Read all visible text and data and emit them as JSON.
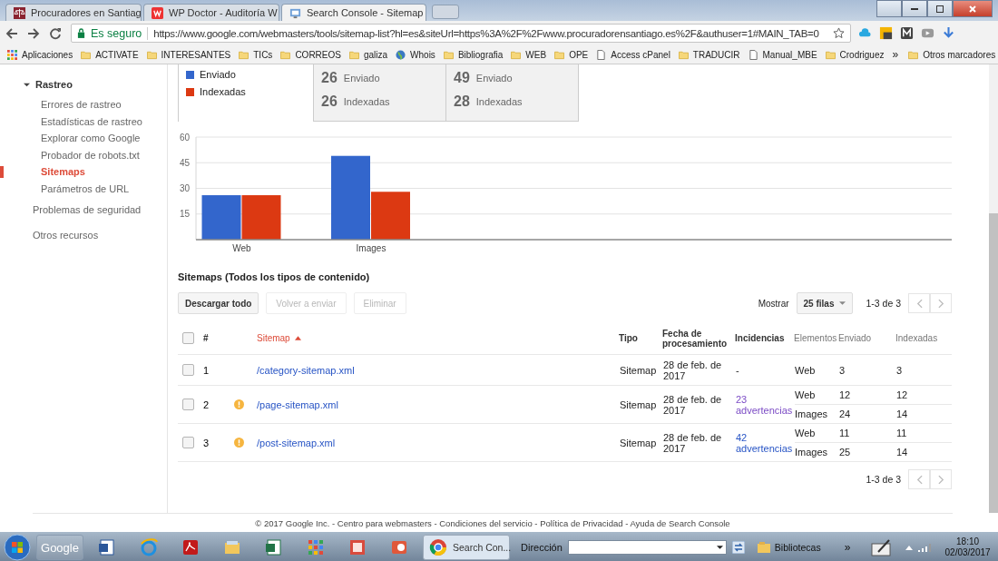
{
  "browser": {
    "tabs": [
      {
        "title": "Procuradores en Santiag",
        "selected": false
      },
      {
        "title": "WP Doctor - Auditoría W",
        "selected": false
      },
      {
        "title": "Search Console - Sitemap",
        "selected": true
      }
    ],
    "security": "Es seguro",
    "url": "https://www.google.com/webmasters/tools/sitemap-list?hl=es&siteUrl=https%3A%2F%2Fwww.procuradorensantiago.es%2F&authuser=1#MAIN_TAB=0",
    "bookmarks": [
      {
        "label": "Aplicaciones",
        "kind": "apps"
      },
      {
        "label": "ACTIVATE",
        "kind": "folder"
      },
      {
        "label": "INTERESANTES",
        "kind": "folder"
      },
      {
        "label": "TICs",
        "kind": "folder"
      },
      {
        "label": "CORREOS",
        "kind": "folder"
      },
      {
        "label": "galiza",
        "kind": "folder"
      },
      {
        "label": "Whois",
        "kind": "globe"
      },
      {
        "label": "Bibliografia",
        "kind": "folder"
      },
      {
        "label": "WEB",
        "kind": "folder"
      },
      {
        "label": "OPE",
        "kind": "folder"
      },
      {
        "label": "Access cPanel",
        "kind": "page"
      },
      {
        "label": "TRADUCIR",
        "kind": "folder"
      },
      {
        "label": "Manual_MBE",
        "kind": "page"
      },
      {
        "label": "Crodriguez",
        "kind": "folder"
      }
    ],
    "bookmarks_more": "»",
    "other_bookmarks": "Otros marcadores"
  },
  "sidebar": {
    "group": {
      "label": "Rastreo",
      "expanded": true,
      "children": [
        {
          "label": "Errores de rastreo",
          "selected": false
        },
        {
          "label": "Estadísticas de rastreo",
          "selected": false
        },
        {
          "label": "Explorar como Google",
          "selected": false
        },
        {
          "label": "Probador de robots.txt",
          "selected": false
        },
        {
          "label": "Sitemaps",
          "selected": true
        },
        {
          "label": "Parámetros de URL",
          "selected": false
        }
      ]
    },
    "links": [
      "Problemas de seguridad",
      "Otros recursos"
    ]
  },
  "summary": {
    "cards": [
      {
        "stats": [
          {
            "value": "26",
            "label": "Enviado"
          },
          {
            "value": "26",
            "label": "Indexadas"
          }
        ]
      },
      {
        "stats": [
          {
            "value": "49",
            "label": "Enviado"
          },
          {
            "value": "28",
            "label": "Indexadas"
          }
        ]
      }
    ]
  },
  "chart": {
    "chart_data": {
      "type": "bar",
      "categories": [
        "Web",
        "Images"
      ],
      "series": [
        {
          "name": "Enviado",
          "color": "#3366cc",
          "values": [
            26,
            49
          ]
        },
        {
          "name": "Indexadas",
          "color": "#dc3912",
          "values": [
            26,
            28
          ]
        }
      ],
      "ylim": [
        0,
        60
      ],
      "yticks": [
        15,
        30,
        45,
        60
      ],
      "grid": true
    }
  },
  "table": {
    "title": "Sitemaps (Todos los tipos de contenido)",
    "actions": [
      {
        "label": "Descargar todo",
        "disabled": false
      },
      {
        "label": "Volver a enviar",
        "disabled": true
      },
      {
        "label": "Eliminar",
        "disabled": true
      }
    ],
    "show_label": "Mostrar",
    "rows_per_page": "25 filas",
    "range": "1-3 de 3",
    "header_checked": false,
    "columns": [
      {
        "label": "#",
        "sorted": false
      },
      {
        "label": "Sitemap",
        "sorted": true
      },
      {
        "label": "Tipo",
        "sorted": false
      },
      {
        "label": "Fecha de procesamiento",
        "sorted": false
      },
      {
        "label": "Incidencias",
        "sorted": false
      },
      {
        "label": "Elementos",
        "sorted": false
      },
      {
        "label": "Enviado",
        "sorted": false
      },
      {
        "label": "Indexadas",
        "sorted": false
      }
    ],
    "rows": [
      {
        "checked": false,
        "num": "1",
        "warning": false,
        "sitemap": "/category-sitemap.xml",
        "type": "Sitemap",
        "date": "28 de feb. de 2017",
        "issues": "-",
        "issues_link": false,
        "items": [
          {
            "type": "Web",
            "submitted": "3",
            "indexed": "3"
          }
        ]
      },
      {
        "checked": false,
        "num": "2",
        "warning": true,
        "sitemap": "/page-sitemap.xml",
        "type": "Sitemap",
        "date": "28 de feb. de 2017",
        "issues": "23 advertencias",
        "issues_link": true,
        "visited": true,
        "items": [
          {
            "type": "Web",
            "submitted": "12",
            "indexed": "12"
          },
          {
            "type": "Images",
            "submitted": "24",
            "indexed": "14"
          }
        ]
      },
      {
        "checked": false,
        "num": "3",
        "warning": true,
        "sitemap": "/post-sitemap.xml",
        "type": "Sitemap",
        "date": "28 de feb. de 2017",
        "issues": "42 advertencias",
        "issues_link": true,
        "visited": false,
        "items": [
          {
            "type": "Web",
            "submitted": "11",
            "indexed": "11"
          },
          {
            "type": "Images",
            "submitted": "25",
            "indexed": "14"
          }
        ]
      }
    ],
    "footer_range": "1-3 de 3"
  },
  "footer": "© 2017 Google Inc. - Centro para webmasters - Condiciones del servicio - Política de Privacidad - Ayuda de Search Console",
  "taskbar": {
    "apps": [
      {
        "kind": "google",
        "label": "Google",
        "selected": false
      },
      {
        "kind": "word",
        "selected": false
      },
      {
        "kind": "ie",
        "selected": false
      },
      {
        "kind": "pdf",
        "selected": false
      },
      {
        "kind": "explorer",
        "selected": false
      },
      {
        "kind": "excel",
        "selected": false
      },
      {
        "kind": "grid",
        "selected": false
      },
      {
        "kind": "paint",
        "selected": false
      },
      {
        "kind": "slides",
        "selected": false
      },
      {
        "kind": "chrome",
        "label": "Search Con...",
        "selected": true
      }
    ],
    "address_label": "Dirección",
    "libraries": "Bibliotecas",
    "more": "»",
    "time": "18:10",
    "date": "02/03/2017"
  }
}
